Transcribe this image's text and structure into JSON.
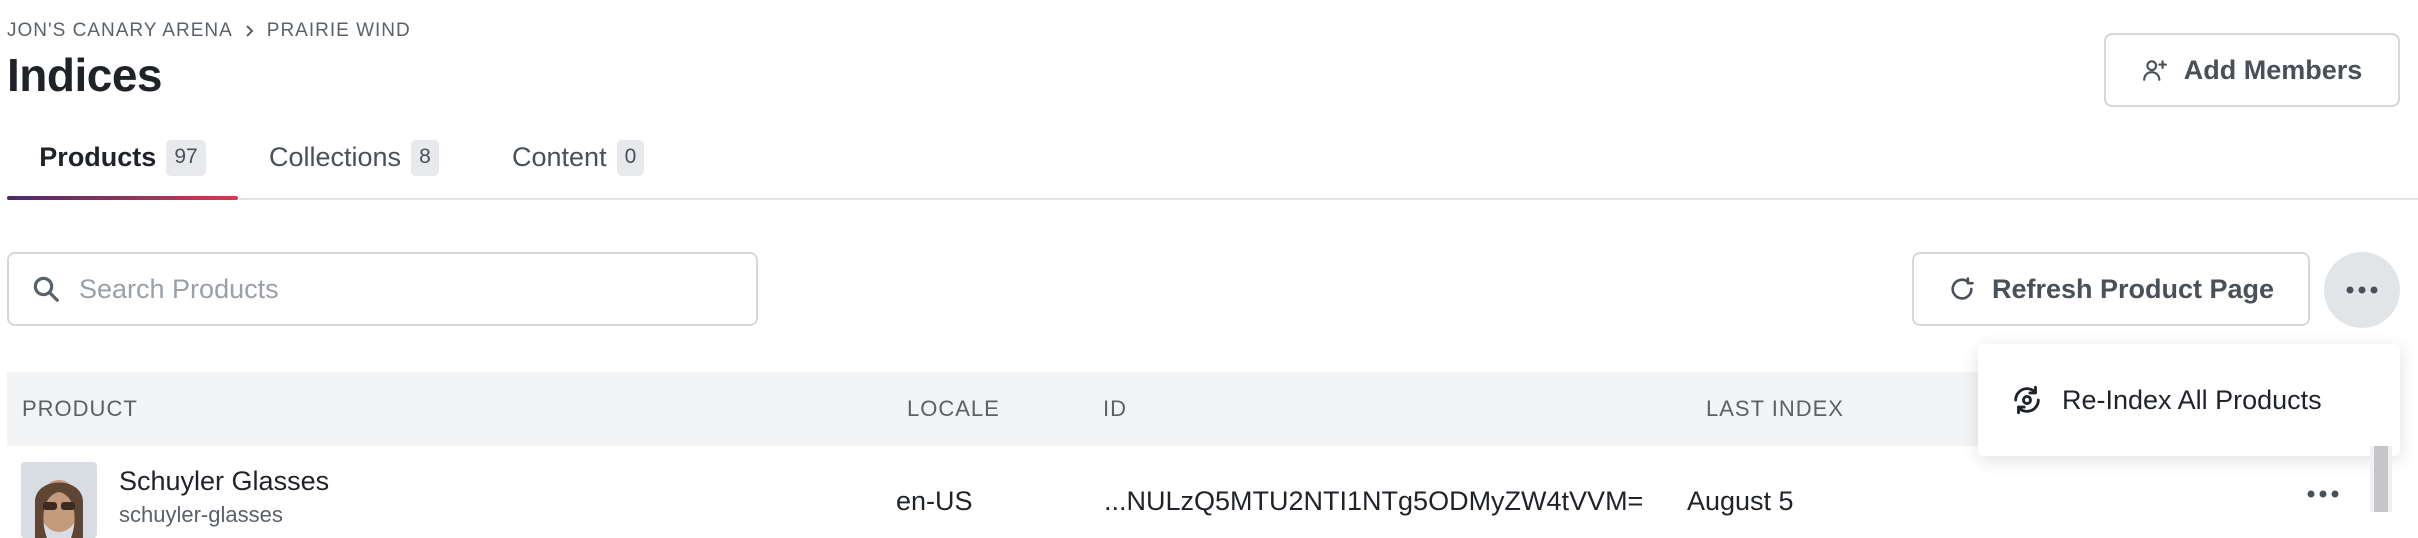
{
  "breadcrumb": {
    "parent": "Jon's Canary Arena",
    "current": "Prairie Wind"
  },
  "header": {
    "title": "Indices",
    "add_members_label": "Add Members"
  },
  "tabs": [
    {
      "label": "Products",
      "count": "97",
      "active": true
    },
    {
      "label": "Collections",
      "count": "8",
      "active": false
    },
    {
      "label": "Content",
      "count": "0",
      "active": false
    }
  ],
  "toolbar": {
    "search_placeholder": "Search Products",
    "search_value": "",
    "refresh_label": "Refresh Product Page"
  },
  "menu": {
    "reindex_label": "Re-Index All Products"
  },
  "table": {
    "columns": [
      "Product",
      "Locale",
      "ID",
      "Last Index"
    ],
    "rows": [
      {
        "name": "Schuyler Glasses",
        "slug": "schuyler-glasses",
        "locale": "en-US",
        "id": "...NULzQ5MTU2NTI1NTg5ODMyZW4tVVM=",
        "last_index": "August 5"
      }
    ]
  },
  "colors": {
    "accent_start": "#4a2a6a",
    "accent_end": "#d03d4f",
    "border": "#d4d7db",
    "header_bg": "#f3f4f6"
  },
  "icons": {
    "add_members": "user-plus-icon",
    "search": "search-icon",
    "refresh": "refresh-icon",
    "more": "more-horizontal-icon",
    "reindex": "reindex-icon",
    "breadcrumb_sep": "chevron-right-icon"
  }
}
